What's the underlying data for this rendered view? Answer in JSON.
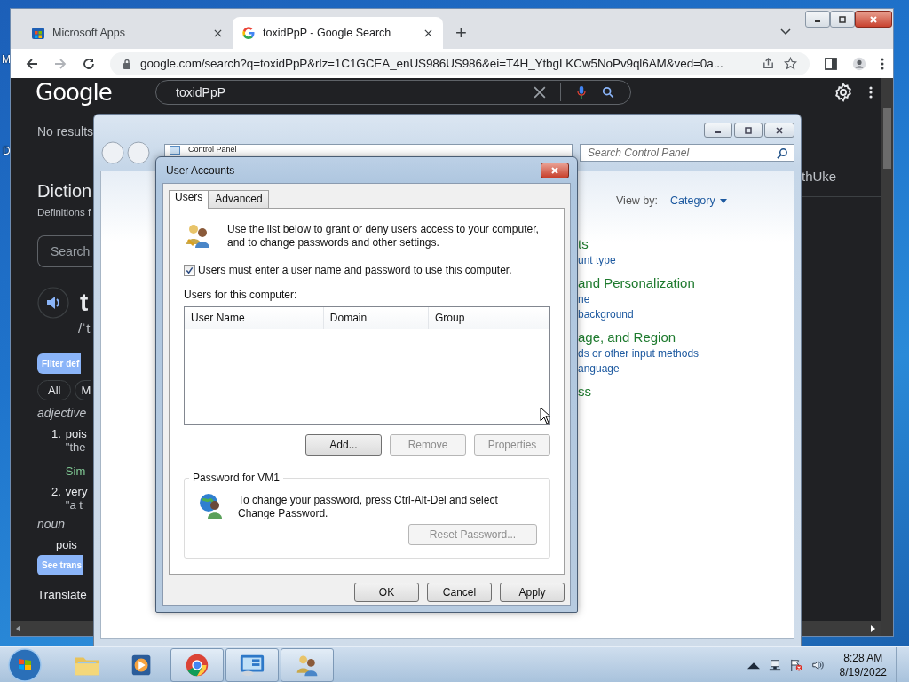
{
  "desktop": {
    "icon_labels": [
      "M",
      "D"
    ]
  },
  "browser": {
    "tabs": [
      {
        "label": "Microsoft Apps",
        "selected": false
      },
      {
        "label": "toxidPpP - Google Search",
        "selected": true
      }
    ],
    "new_tab": "+",
    "url": "google.com/search?q=toxidPpP&rlz=1C1GCEA_enUS986US986&ei=T4H_YtbgLKCw5NoPv9ql6AM&ved=0a...",
    "google": {
      "logo": "Google",
      "query": "toxidPpP"
    },
    "dictionary": {
      "status": "No results",
      "title": "Diction",
      "subtitle": "Definitions f",
      "search_placeholder": "Search",
      "word": "t",
      "phonetic": "/ˈt",
      "filter_button": "Filter def",
      "chips": [
        "All",
        "M"
      ],
      "senses": [
        {
          "pos": "adjective",
          "definitions": [
            {
              "number": "1.",
              "text": "pois",
              "example": "\"the",
              "similar": "Sim"
            },
            {
              "number": "2.",
              "text": "very",
              "example": "\"a t"
            }
          ]
        },
        {
          "pos": "noun",
          "definitions": [
            {
              "text": "pois"
            }
          ]
        }
      ],
      "translate_tooltip": "See trans",
      "translate_heading": "Translate"
    },
    "right_text": "thUke"
  },
  "control_panel": {
    "address": "Control Panel",
    "search_placeholder": "Search Control Panel",
    "view_by_label": "View by:",
    "view_by_value": "Category",
    "categories": [
      {
        "title": "ts",
        "links": [
          "unt type"
        ]
      },
      {
        "title": "and Personalization",
        "links": [
          "ne",
          "background"
        ]
      },
      {
        "title": "age, and Region",
        "links": [
          "ds or other input methods",
          "anguage"
        ]
      },
      {
        "title": "ss"
      }
    ]
  },
  "dialog": {
    "title": "User Accounts",
    "tabs": [
      {
        "label": "Users",
        "selected": true
      },
      {
        "label": "Advanced",
        "selected": false
      }
    ],
    "intro": "Use the list below to grant or deny users access to your computer, and to change passwords and other settings.",
    "require_login": {
      "label": "Users must enter a user name and password to use this computer.",
      "checked": true
    },
    "users_label": "Users for this computer:",
    "columns": [
      "User Name",
      "Domain",
      "Group"
    ],
    "list_buttons": [
      {
        "label": "Add...",
        "disabled": false
      },
      {
        "label": "Remove",
        "disabled": true
      },
      {
        "label": "Properties",
        "disabled": true
      }
    ],
    "password_group": {
      "title": "Password for VM1",
      "text": "To change your password, press Ctrl-Alt-Del and select Change Password.",
      "button": {
        "label": "Reset Password...",
        "disabled": true
      }
    },
    "buttons": [
      {
        "label": "OK",
        "disabled": false
      },
      {
        "label": "Cancel",
        "disabled": false
      },
      {
        "label": "Apply",
        "disabled": false
      }
    ]
  },
  "taskbar": {
    "items": [
      {
        "kind": "folder",
        "running": false
      },
      {
        "kind": "media",
        "running": false
      },
      {
        "kind": "chrome",
        "running": true
      },
      {
        "kind": "control",
        "running": true
      },
      {
        "kind": "users",
        "running": true
      }
    ],
    "time": "8:28 AM",
    "date": "8/19/2022"
  }
}
